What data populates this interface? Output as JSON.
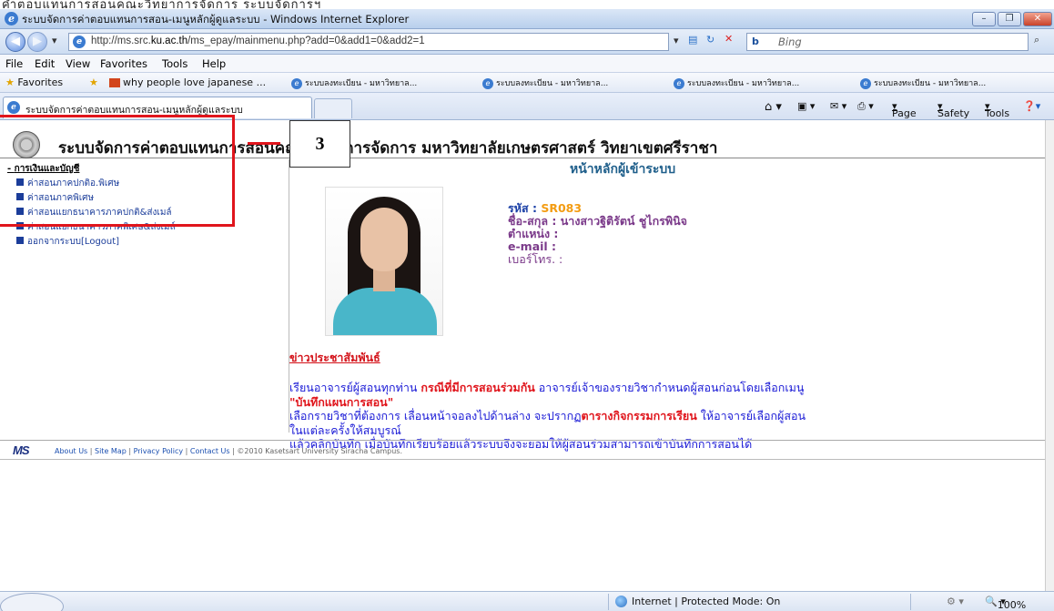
{
  "caption_top": "คำตอบแทนการสอนคณะวิทยาการจัดการ ระบบจัดการฯ",
  "window": {
    "title": "ระบบจัดการค่าตอบแทนการสอน-เมนูหลักผู้ดูแลระบบ - Windows Internet Explorer",
    "min": "–",
    "max": "❐",
    "close": "✕"
  },
  "address": {
    "url_prefix": "http://ms.src.",
    "url_domain": "ku.ac.th",
    "url_suffix": "/ms_epay/mainmenu.php?add=0&add1=0&add2=1",
    "search_placeholder": "Bing",
    "search_logo": "b"
  },
  "menu": {
    "file": "File",
    "edit": "Edit",
    "view": "View",
    "favorites": "Favorites",
    "tools": "Tools",
    "help": "Help"
  },
  "favorites_bar": {
    "label": "Favorites",
    "items": [
      "why people love japanese ...",
      "ระบบลงทะเบียน - มหาวิทยาล...",
      "ระบบลงทะเบียน - มหาวิทยาล...",
      "ระบบลงทะเบียน - มหาวิทยาล...",
      "ระบบลงทะเบียน - มหาวิทยาล..."
    ]
  },
  "tab": {
    "title": "ระบบจัดการค่าตอบแทนการสอน-เมนูหลักผู้ดูแลระบบ"
  },
  "command_bar": {
    "page": "Page",
    "safety": "Safety",
    "tools": "Tools"
  },
  "site": {
    "title": "ระบบจัดการค่าตอบแทนการสอนคณะวิทยาการจัดการ มหาวิทยาลัยเกษตรศาสตร์ วิทยาเขตศรีราชา",
    "page_title": "หน้าหลักผู้เข้าระบบ"
  },
  "sidebar": {
    "section": "การเงินและบัญชี",
    "items": [
      "ค่าสอนภาคปกติอ.พิเศษ",
      "ค่าสอนภาคพิเศษ",
      "ค่าสอนแยกธนาคารภาคปกติ&ส่งเมล์",
      "ค่าสอนแยกธนาคารภาคพิเศษ&ส่งเมล์",
      "ออกจากระบบ[Logout]"
    ]
  },
  "annotation": {
    "number": "3"
  },
  "profile": {
    "code_label": "รหัส",
    "code_value": "SR083",
    "name_label": "ชื่อ-สกุล",
    "name_value": "นางสาวฐิติรัตน์ ชูไกรพินิจ",
    "position_label": "ตำแหน่ง :",
    "email_label": "e-mail :",
    "phone_label": "เบอร์โทร. :"
  },
  "news": {
    "heading": "ข่าวประชาสัมพันธ์",
    "l1a": "เรียนอาจารย์ผู้สอนทุกท่าน",
    "l1b": "กรณีที่มีการสอนร่วมกัน",
    "l1c": "อาจารย์เจ้าของรายวิชากำหนดผู้สอนก่อนโดยเลือกเมนู",
    "l1d": "\"บันทึกแผนการสอน\"",
    "l2a": "เลือกรายวิชาที่ต้องการ เลื่อนหน้าจอลงไปด้านล่าง จะปรากฏ",
    "l2b": "ตารางกิจกรรมการเรียน",
    "l2c": "ให้อาจารย์เลือกผู้สอน",
    "l3": "ในแต่ละครั้งให้สมบูรณ์",
    "l4": "แล้วคลิกบันทึก เมื่อบันทึกเรียบร้อยแล้วระบบจึงจะยอมให้ผู้สอนร่วมสามารถเข้าบันทึกการสอนได้"
  },
  "footer": {
    "logo": "MS",
    "links": [
      "About Us",
      "Site Map",
      "Privacy Policy",
      "Contact Us"
    ],
    "copyright": "©2010 Kasetsart University Siracha Campus."
  },
  "status": {
    "zone": "Internet | Protected Mode: On",
    "zoom": "100%"
  }
}
